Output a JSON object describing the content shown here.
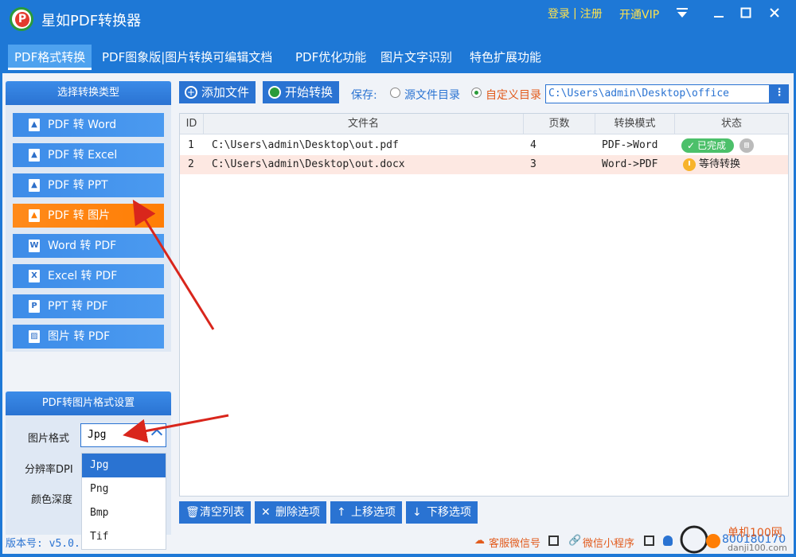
{
  "app": {
    "title": "星如PDF转换器",
    "logo_letter": "P",
    "login": "登录",
    "link_sep": "|",
    "register": "注册",
    "vip": "开通VIP"
  },
  "menu": {
    "tabs": [
      {
        "label": "PDF格式转换"
      },
      {
        "label": "PDF图象版|图片转换可编辑文档"
      },
      {
        "label": "PDF优化功能"
      },
      {
        "label": "图片文字识别"
      },
      {
        "label": "特色扩展功能"
      }
    ]
  },
  "left_panel": {
    "header": "选择转换类型",
    "types": [
      {
        "label": "PDF 转 Word"
      },
      {
        "label": "PDF 转 Excel"
      },
      {
        "label": "PDF 转 PPT"
      },
      {
        "label": "PDF 转 图片"
      },
      {
        "label": "Word 转 PDF"
      },
      {
        "label": "Excel 转 PDF"
      },
      {
        "label": "PPT  转 PDF"
      },
      {
        "label": "图片 转 PDF"
      }
    ]
  },
  "settings": {
    "header": "PDF转图片格式设置",
    "format_label": "图片格式",
    "format_value": "Jpg",
    "dpi_label": "分辨率DPI",
    "depth_label": "颜色深度",
    "options": [
      "Jpg",
      "Png",
      "Bmp",
      "Tif"
    ]
  },
  "toolbar": {
    "add_file": "添加文件",
    "start": "开始转换",
    "save_label": "保存:",
    "source_dir": "源文件目录",
    "custom_dir": "自定义目录",
    "path": "C:\\Users\\admin\\Desktop\\office",
    "more": "⋮"
  },
  "table": {
    "columns": [
      "ID",
      "文件名",
      "页数",
      "转换模式",
      "状态"
    ],
    "rows": [
      {
        "id": "1",
        "file": "C:\\Users\\admin\\Desktop\\out.pdf",
        "pages": "4",
        "mode": "PDF->Word",
        "status": "已完成"
      },
      {
        "id": "2",
        "file": "C:\\Users\\admin\\Desktop\\out.docx",
        "pages": "3",
        "mode": "Word->PDF",
        "status": "等待转换"
      }
    ]
  },
  "bottom": {
    "clear": "清空列表",
    "delete": "删除选项",
    "up": "上移选项",
    "down": "下移选项"
  },
  "status": {
    "version": "版本号: v5.0.",
    "wechat": "客服微信号",
    "mini": "微信小程序",
    "phone": "800180170"
  },
  "watermark": {
    "text": "单机100网",
    "domain": "danji100.com"
  },
  "colors": {
    "primary": "#1e78d6",
    "accent": "#ff7e05",
    "success": "#4cc06a"
  }
}
